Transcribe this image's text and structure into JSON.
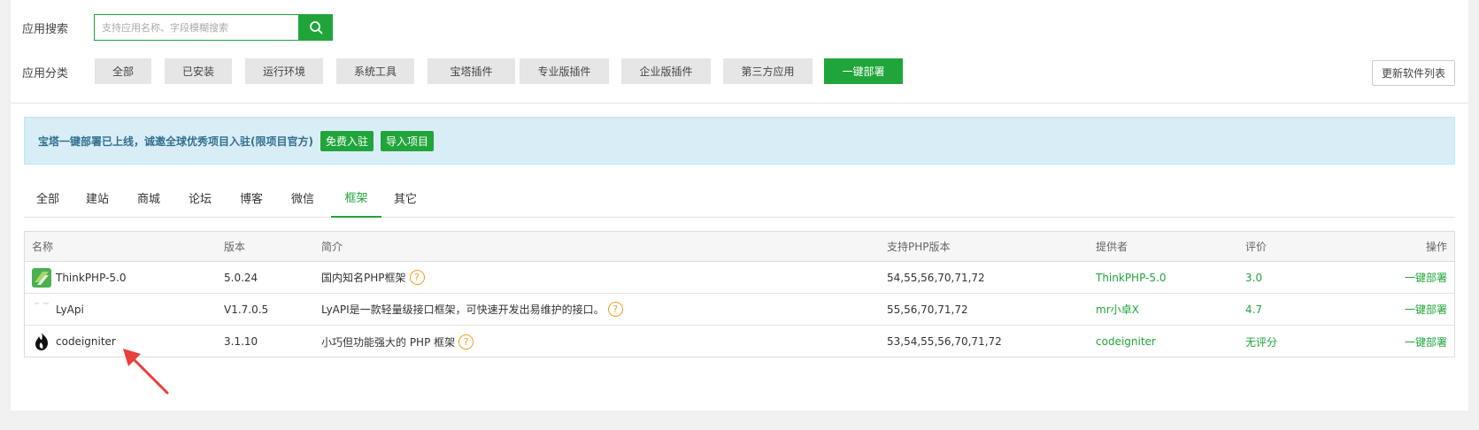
{
  "search": {
    "label": "应用搜索",
    "placeholder": "支持应用名称、字段模糊搜索"
  },
  "category": {
    "label": "应用分类",
    "buttons": [
      "全部",
      "已安装",
      "运行环境",
      "系统工具",
      "宝塔插件",
      "专业版插件",
      "企业版插件",
      "第三方应用",
      "一键部署"
    ],
    "active": "一键部署"
  },
  "refresh_label": "更新软件列表",
  "notice": {
    "text": "宝塔一键部署已上线，诚邀全球优秀项目入驻(限项目官方)",
    "free_join": "免费入驻",
    "import_project": "导入项目"
  },
  "tabs": [
    "全部",
    "建站",
    "商城",
    "论坛",
    "博客",
    "微信",
    "框架",
    "其它"
  ],
  "active_tab": "框架",
  "table": {
    "headers": [
      "名称",
      "版本",
      "简介",
      "支持PHP版本",
      "提供者",
      "评价",
      "操作"
    ],
    "rows": [
      {
        "name": "ThinkPHP-5.0",
        "version": "5.0.24",
        "desc": "国内知名PHP框架",
        "php": "54,55,56,70,71,72",
        "provider": "ThinkPHP-5.0",
        "rating": "3.0",
        "action": "一键部署",
        "icon": "thinkphp-icon"
      },
      {
        "name": "LyApi",
        "version": "V1.7.0.5",
        "desc": "LyAPI是一款轻量级接口框架，可快速开发出易维护的接口。",
        "php": "55,56,70,71,72",
        "provider": "mr小卓X",
        "rating": "4.7",
        "action": "一键部署",
        "icon": "lyapi-icon"
      },
      {
        "name": "codeigniter",
        "version": "3.1.10",
        "desc": "小巧但功能强大的 PHP 框架",
        "php": "53,54,55,56,70,71,72",
        "provider": "codeigniter",
        "rating": "无评分",
        "action": "一键部署",
        "icon": "codeigniter-flame-icon"
      }
    ]
  },
  "colors": {
    "brand_green": "#20a53a",
    "notice_bg": "#d9edf7",
    "arrow_red": "#e8403a"
  }
}
